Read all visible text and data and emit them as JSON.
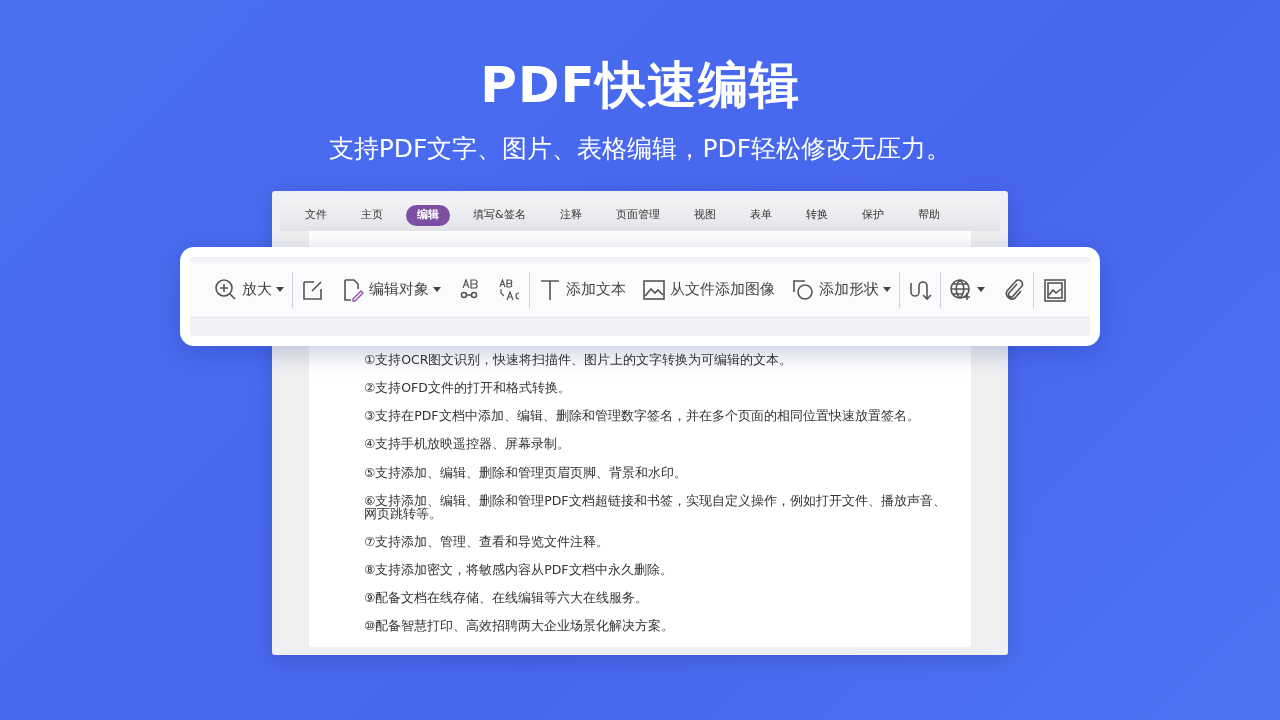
{
  "headline": "PDF快速编辑",
  "subtitle": "支持PDF文字、图片、表格编辑，PDF轻松修改无压力。",
  "menu_tabs": [
    {
      "label": "文件",
      "selected": false
    },
    {
      "label": "主页",
      "selected": false
    },
    {
      "label": "编辑",
      "selected": true
    },
    {
      "label": "填写&签名",
      "selected": false
    },
    {
      "label": "注释",
      "selected": false
    },
    {
      "label": "页面管理",
      "selected": false
    },
    {
      "label": "视图",
      "selected": false
    },
    {
      "label": "表单",
      "selected": false
    },
    {
      "label": "转换",
      "selected": false
    },
    {
      "label": "保护",
      "selected": false
    },
    {
      "label": "帮助",
      "selected": false
    }
  ],
  "toolbar": [
    {
      "kind": "tool",
      "label": "放大",
      "dropdown": true
    },
    {
      "kind": "separator"
    },
    {
      "kind": "tool",
      "dropdown": false
    },
    {
      "kind": "tool",
      "label": "编辑对象",
      "dropdown": true
    },
    {
      "kind": "tool",
      "dropdown": false
    },
    {
      "kind": "tool",
      "dropdown": false
    },
    {
      "kind": "separator"
    },
    {
      "kind": "tool",
      "label": "添加文本",
      "dropdown": false
    },
    {
      "kind": "tool",
      "label": "从文件添加图像",
      "dropdown": false
    },
    {
      "kind": "tool",
      "label": "添加形状",
      "dropdown": true
    },
    {
      "kind": "separator"
    },
    {
      "kind": "tool",
      "dropdown": false
    },
    {
      "kind": "separator"
    },
    {
      "kind": "tool",
      "dropdown": true
    },
    {
      "kind": "tool",
      "dropdown": false
    },
    {
      "kind": "separator"
    },
    {
      "kind": "tool",
      "dropdown": false
    }
  ],
  "document_lines": [
    "①支持OCR图文识别，快速将扫描件、图片上的文字转换为可编辑的文本。",
    "②支持OFD文件的打开和格式转换。",
    "③支持在PDF文档中添加、编辑、删除和管理数字签名，并在多个页面的相同位置快速放置签名。",
    "④支持手机放映遥控器、屏幕录制。",
    "⑤支持添加、编辑、删除和管理页眉页脚、背景和水印。",
    "⑥支持添加、编辑、删除和管理PDF文档超链接和书签，实现自定义操作，例如打开文件、播放声音、网页跳转等。",
    "⑦支持添加、管理、查看和导览文件注释。",
    "⑧支持添加密文，将敏感内容从PDF文档中永久删除。",
    "⑨配备文档在线存储、在线编辑等六大在线服务。",
    "⑩配备智慧打印、高效招聘两大企业场景化解决方案。"
  ]
}
